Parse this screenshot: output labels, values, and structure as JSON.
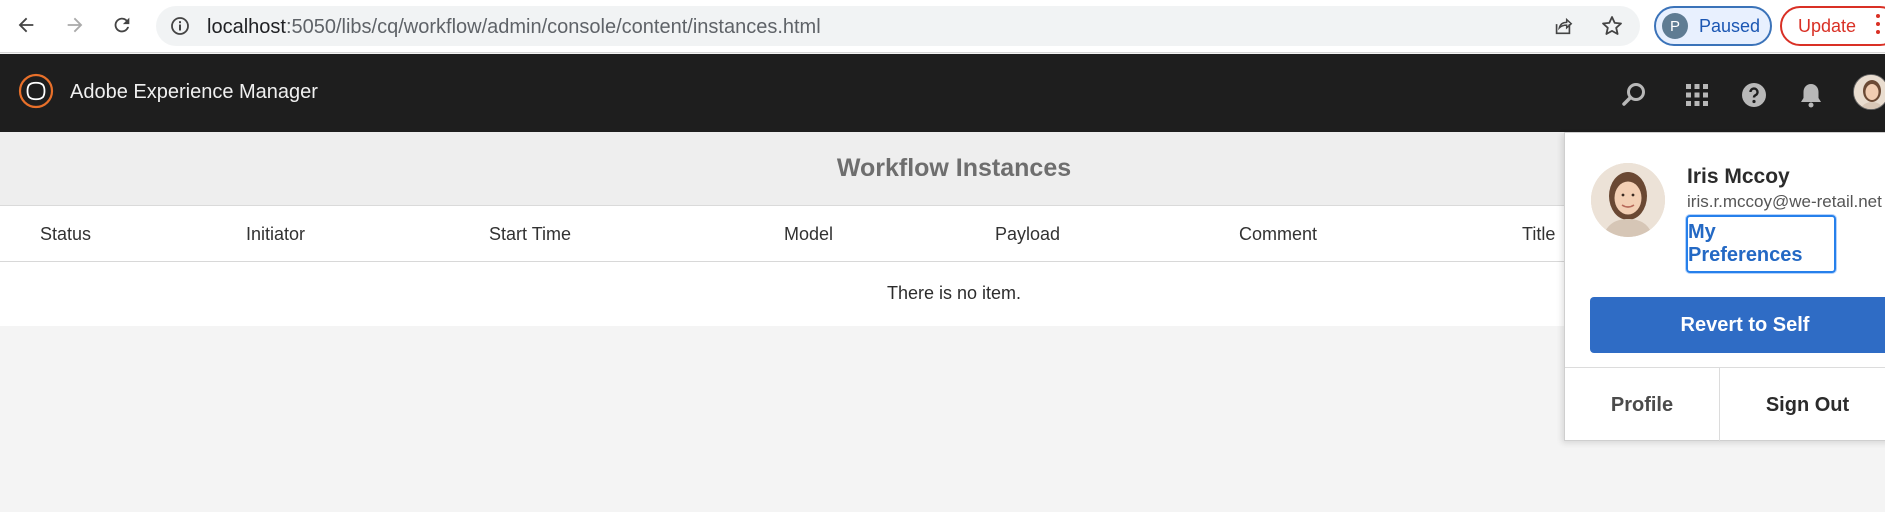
{
  "browser": {
    "url_host": "localhost",
    "url_path": ":5050/libs/cq/workflow/admin/console/content/instances.html",
    "profile_initial": "P",
    "profile_status": "Paused",
    "update_label": "Update",
    "icons": [
      "back-icon",
      "forward-icon",
      "reload-icon",
      "info-icon",
      "share-icon",
      "star-icon",
      "kebab-icon"
    ]
  },
  "header": {
    "app_title": "Adobe Experience Manager",
    "icons": [
      "search-icon",
      "apps-grid-icon",
      "help-icon",
      "bell-icon",
      "avatar"
    ]
  },
  "page": {
    "title": "Workflow Instances"
  },
  "table": {
    "columns": [
      "Status",
      "Initiator",
      "Start Time",
      "Model",
      "Payload",
      "Comment",
      "Title"
    ],
    "empty_message": "There is no item."
  },
  "profile_popover": {
    "name": "Iris Mccoy",
    "email": "iris.r.mccoy@we-retail.net",
    "preferences_label": "My Preferences",
    "revert_label": "Revert to Self",
    "profile_label": "Profile",
    "signout_label": "Sign Out"
  },
  "colors": {
    "header_bg": "#1e1e1e",
    "accent_blue": "#2f6cc5",
    "logo_orange": "#e8702a"
  }
}
